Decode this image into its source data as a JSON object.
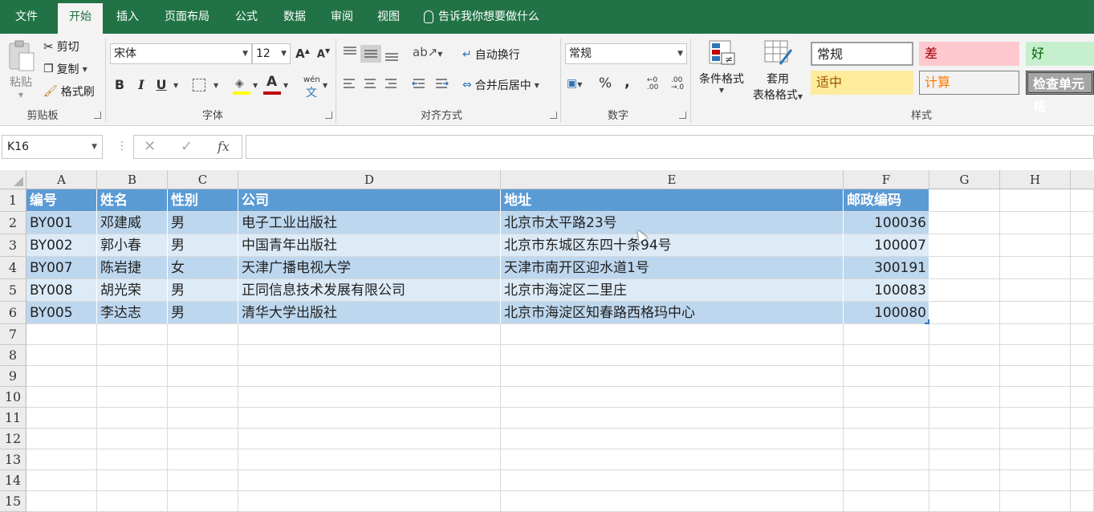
{
  "tabs": [
    "文件",
    "开始",
    "插入",
    "页面布局",
    "公式",
    "数据",
    "审阅",
    "视图"
  ],
  "tell_me": "告诉我你想要做什么",
  "clipboard": {
    "paste": "粘贴",
    "cut": "剪切",
    "copy": "复制",
    "format_painter": "格式刷",
    "label": "剪贴板"
  },
  "font": {
    "name": "宋体",
    "size": "12",
    "label": "字体",
    "bold": "B",
    "italic": "I",
    "underline": "U",
    "phonetic": "wén"
  },
  "alignment": {
    "wrap": "自动换行",
    "merge": "合并后居中",
    "label": "对齐方式"
  },
  "number": {
    "format": "常规",
    "label": "数字",
    "percent": "%",
    "comma": ","
  },
  "styles": {
    "cond_format": "条件格式",
    "table_format_1": "套用",
    "table_format_2": "表格格式",
    "label": "样式",
    "cells": [
      "常规",
      "差",
      "好",
      "适中",
      "计算",
      "检查单元格"
    ]
  },
  "formula_bar": {
    "name_box": "K16",
    "fx": "fx",
    "value": ""
  },
  "columns": [
    "A",
    "B",
    "C",
    "D",
    "E",
    "F",
    "G",
    "H"
  ],
  "rows": [
    "1",
    "2",
    "3",
    "4",
    "5",
    "6",
    "7",
    "8",
    "9",
    "10",
    "11",
    "12",
    "13",
    "14",
    "15"
  ],
  "table": {
    "header": [
      "编号",
      "姓名",
      "性别",
      "公司",
      "地址",
      "邮政编码"
    ],
    "data": [
      [
        "BY001",
        "邓建威",
        "男",
        "电子工业出版社",
        "北京市太平路23号",
        "100036"
      ],
      [
        "BY002",
        "郭小春",
        "男",
        "中国青年出版社",
        "北京市东城区东四十条94号",
        "100007"
      ],
      [
        "BY007",
        "陈岩捷",
        "女",
        "天津广播电视大学",
        "天津市南开区迎水道1号",
        "300191"
      ],
      [
        "BY008",
        "胡光荣",
        "男",
        "正同信息技术发展有限公司",
        "北京市海淀区二里庄",
        "100083"
      ],
      [
        "BY005",
        "李达志",
        "男",
        "清华大学出版社",
        "北京市海淀区知春路西格玛中心",
        "100080"
      ]
    ]
  },
  "colors": {
    "accent": "#217346",
    "header_fill": "#5b9bd5",
    "band_dark": "#bdd7ee",
    "band_light": "#ddebf7"
  }
}
